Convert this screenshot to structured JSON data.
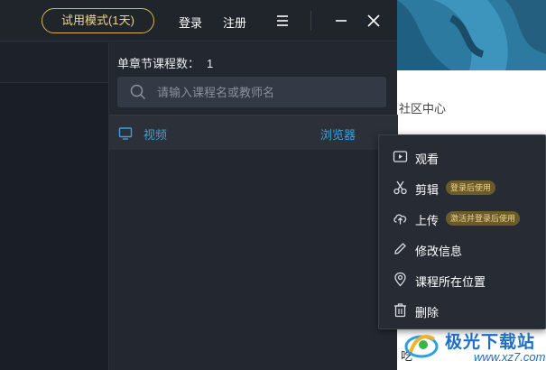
{
  "titlebar": {
    "trial_label": "试用模式(1天)",
    "login_label": "登录",
    "register_label": "注册",
    "icons": [
      "menu-icon",
      "minimize-icon",
      "close-icon"
    ]
  },
  "main": {
    "count_label": "单章节课程数：",
    "count_value": "1",
    "search_placeholder": "请输入课程名或教师名",
    "tabs": [
      {
        "label": "视频",
        "icon": "monitor-icon"
      },
      {
        "label": "浏览器"
      }
    ]
  },
  "context_menu": {
    "items": [
      {
        "label": "观看",
        "icon": "play-video-icon"
      },
      {
        "label": "剪辑",
        "icon": "scissors-icon",
        "badge": "登录后使用"
      },
      {
        "label": "上传",
        "icon": "cloud-upload-icon",
        "badge": "激活并登录后使用"
      },
      {
        "label": "修改信息",
        "icon": "pencil-icon"
      },
      {
        "label": "课程所在位置",
        "icon": "location-pin-icon"
      },
      {
        "label": "删除",
        "icon": "trash-icon"
      }
    ]
  },
  "background_page": {
    "community_label": "社区中心",
    "partial_text": "吃"
  },
  "watermark": {
    "site_name": "极光下载站",
    "site_url": "www.xz7.com"
  },
  "colors": {
    "accent_gold": "#e2b34a",
    "link_blue": "#3fa0d8",
    "badge_bg": "#6b5a2a",
    "badge_text": "#f0d68a",
    "window_bg": "#1e232c"
  }
}
